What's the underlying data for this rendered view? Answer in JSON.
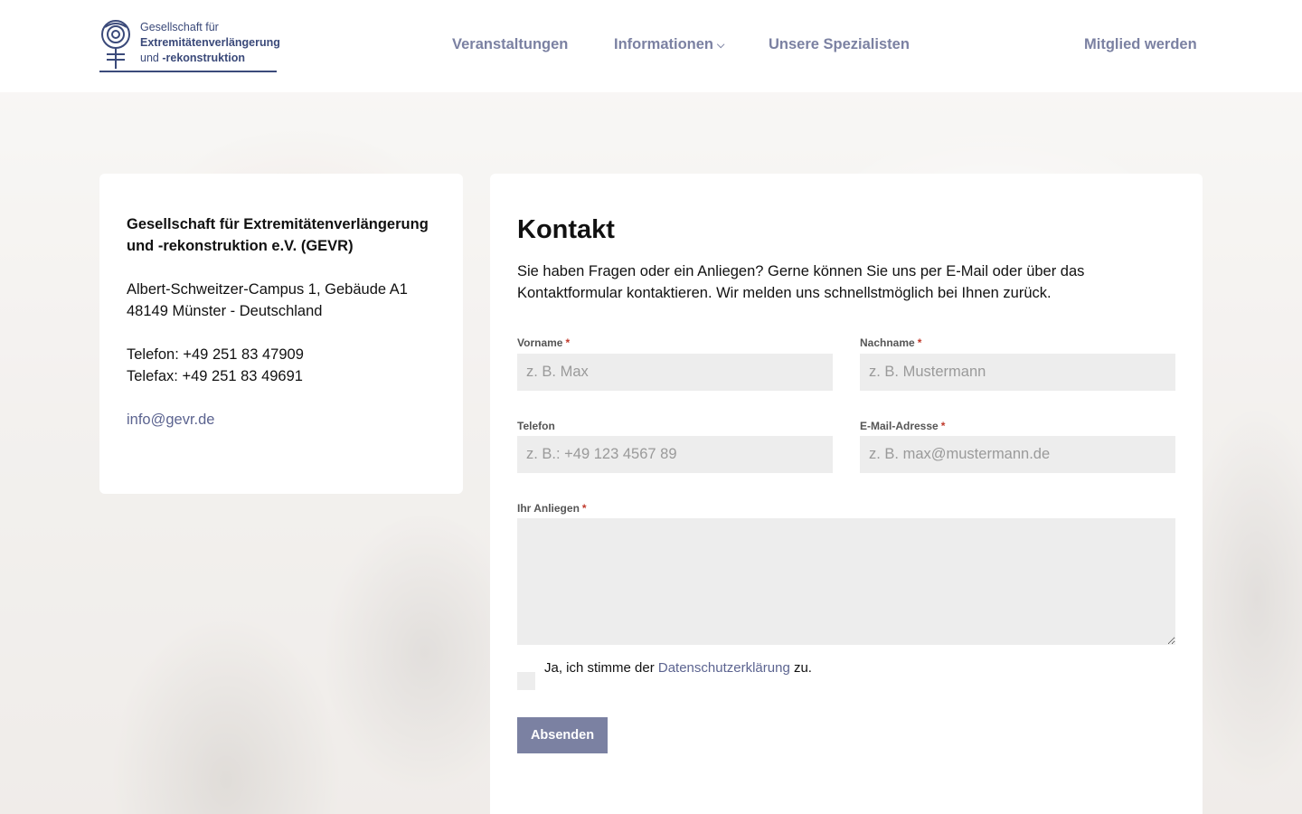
{
  "logo": {
    "line1": "Gesellschaft für",
    "line2": "Extremitätenverlängerung",
    "line3_prefix": "und ",
    "line3_bold": "-rekonstruktion"
  },
  "nav": {
    "items": [
      {
        "label": "Veranstaltungen"
      },
      {
        "label": "Informationen"
      },
      {
        "label": "Unsere Spezialisten"
      }
    ],
    "cta": "Mitglied werden",
    "dropdown_glyph": "⌵"
  },
  "contact_card": {
    "org_name": "Gesellschaft für Extremitätenverlängerung und -rekonstruktion e.V. (GEVR)",
    "address_line1": "Albert-Schweitzer-Campus 1, Gebäude A1",
    "address_line2": "48149 Münster - Deutschland",
    "phone": "Telefon: +49 251 83 47909",
    "fax": "Telefax: +49 251 83 49691",
    "email": "info@gevr.de"
  },
  "form": {
    "title": "Kontakt",
    "intro": "Sie haben Fragen  oder ein Anliegen? Gerne können Sie uns per E-Mail oder über das Kontaktformular kontaktieren. Wir melden uns schnellstmöglich bei Ihnen zurück.",
    "required_marker": "*",
    "firstname": {
      "label": "Vorname",
      "placeholder": "z. B. Max",
      "value": ""
    },
    "lastname": {
      "label": "Nachname",
      "placeholder": "z. B. Mustermann",
      "value": ""
    },
    "phone": {
      "label": "Telefon",
      "placeholder": "z. B.: +49 123 4567 89",
      "value": ""
    },
    "email": {
      "label": "E-Mail-Adresse",
      "placeholder": "z. B. max@mustermann.de",
      "value": ""
    },
    "message": {
      "label": "Ihr Anliegen",
      "value": ""
    },
    "consent": {
      "prefix": "Ja, ich stimme der ",
      "link": "Datenschutzerklärung",
      "suffix": " zu.",
      "checked": false
    },
    "submit_label": "Absenden"
  },
  "colors": {
    "accent": "#7b81a2",
    "logo_blue": "#3b4a7a",
    "required": "#c0392b",
    "input_bg": "#ededed"
  }
}
